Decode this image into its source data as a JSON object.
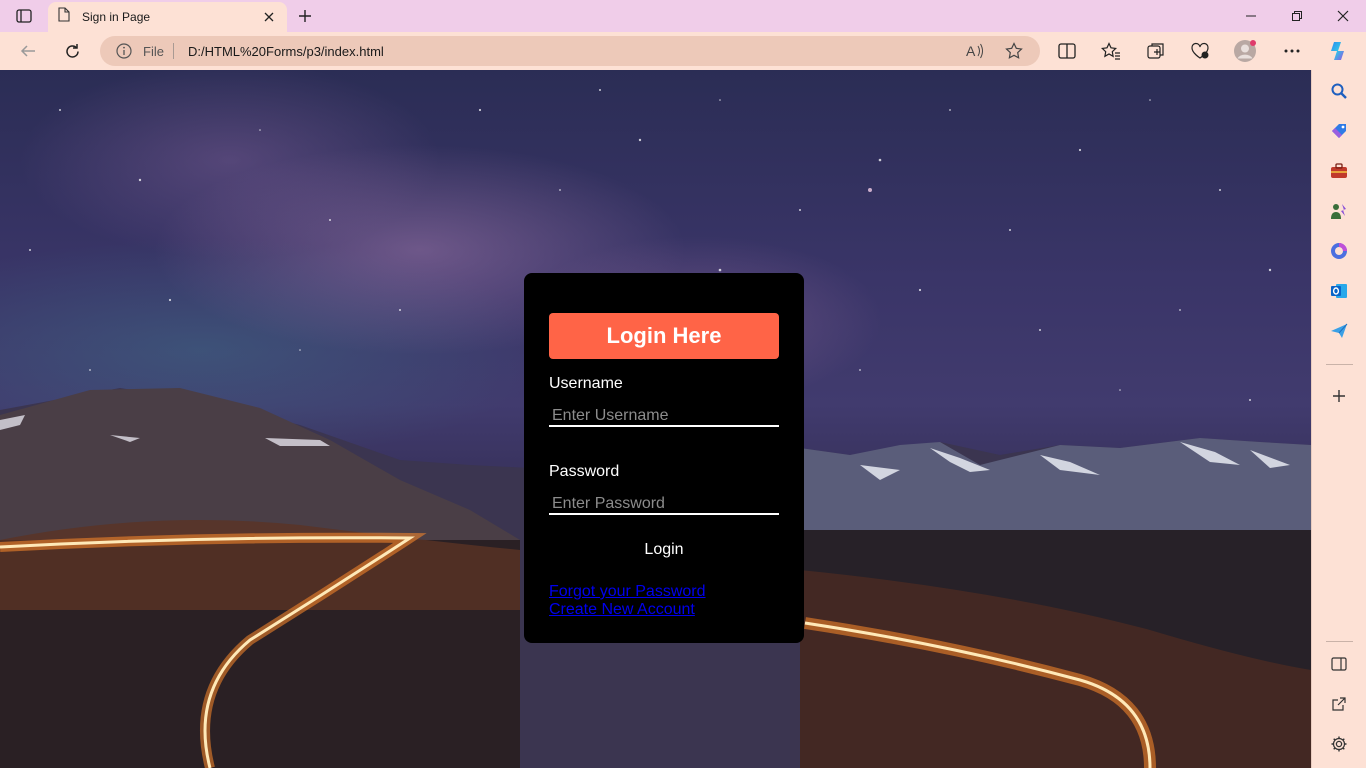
{
  "browser": {
    "tab_title": "Sign in Page",
    "omnibox_label": "File",
    "url": "D:/HTML%20Forms/p3/index.html"
  },
  "login": {
    "heading": "Login Here",
    "username_label": "Username",
    "username_placeholder": "Enter Username",
    "password_label": "Password",
    "password_placeholder": "Enter Password",
    "submit_label": "Login",
    "forgot_link": "Forgot your Password",
    "create_link": "Create New Account"
  },
  "colors": {
    "titlebar": "#f0cde9",
    "toolbar": "#fde1d5",
    "card": "#000000",
    "accent": "#ff6447",
    "link": "#0000ee"
  },
  "icons": {
    "sidebar": [
      "search-icon",
      "shopping-tag-icon",
      "tools-icon",
      "games-icon",
      "copilot-app-icon",
      "outlook-icon",
      "send-icon",
      "add-icon",
      "split-panel-icon",
      "external-link-icon",
      "settings-icon"
    ]
  }
}
